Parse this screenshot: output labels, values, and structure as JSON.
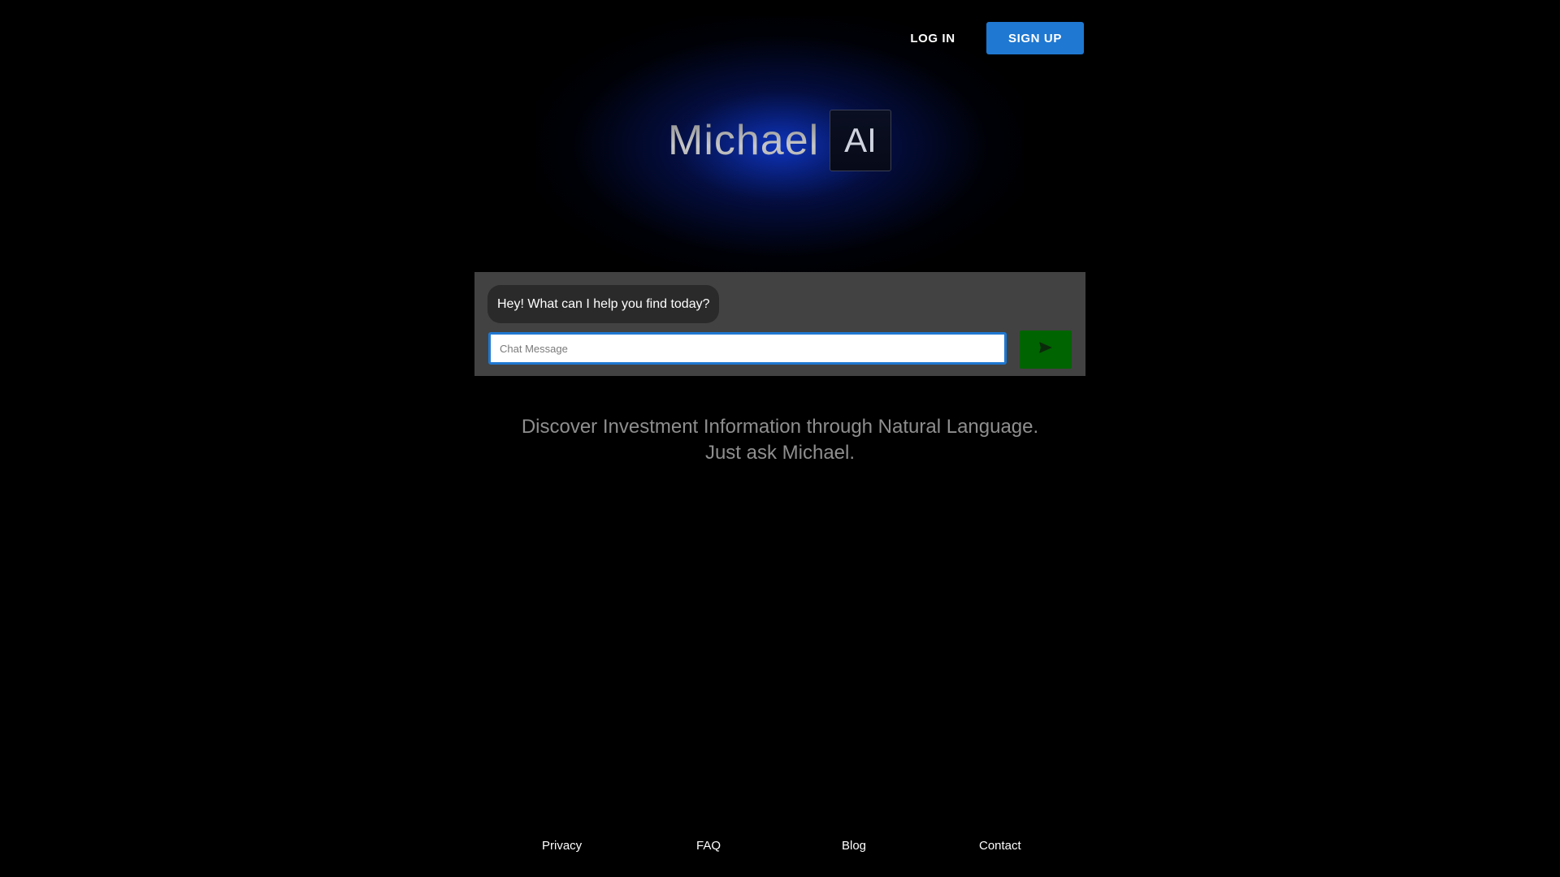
{
  "header": {
    "login_label": "LOG IN",
    "signup_label": "SIGN UP"
  },
  "logo": {
    "text": "Michael",
    "badge": "AI"
  },
  "chat": {
    "greeting": "Hey! What can I help you find today?",
    "input_placeholder": "Chat Message",
    "input_value": "",
    "send_icon": "send-icon"
  },
  "tagline": {
    "line1": "Discover Investment Information through Natural Language.",
    "line2": "Just ask Michael."
  },
  "footer": {
    "links": [
      "Privacy",
      "FAQ",
      "Blog",
      "Contact"
    ]
  },
  "colors": {
    "background": "#000000",
    "signup_button": "#1f78d1",
    "send_button": "#006400",
    "chat_panel": "#424242",
    "glow": "#103cdc"
  }
}
